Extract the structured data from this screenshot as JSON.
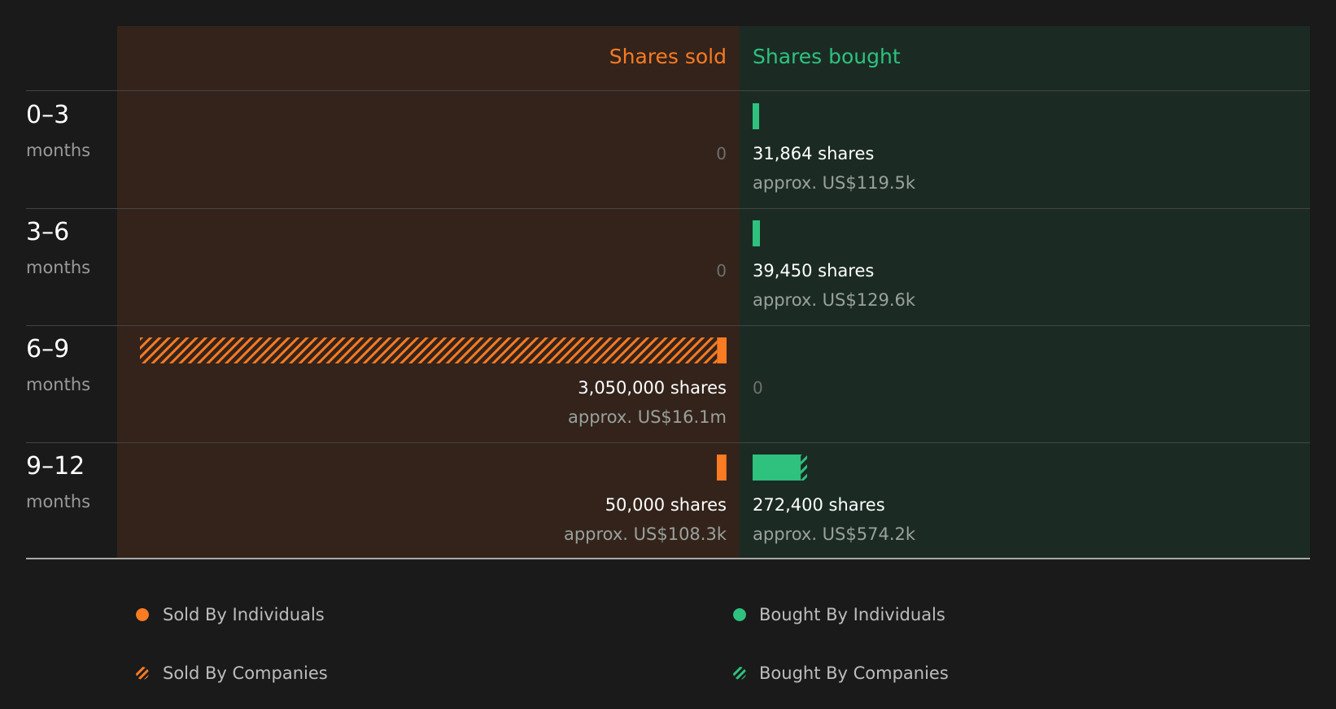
{
  "colors": {
    "sold": "#f97b22",
    "bought": "#2ec27e",
    "sold_panel": "#33231b",
    "bought_panel": "#1b2b24"
  },
  "header": {
    "sold_title": "Shares sold",
    "bought_title": "Shares bought"
  },
  "chart_data": {
    "type": "bar",
    "orientation": "diverging-horizontal",
    "categories": [
      "0–3",
      "3–6",
      "6–9",
      "9–12"
    ],
    "category_unit": "months",
    "x_max_shares": 3100000,
    "rows": [
      {
        "period": "0–3",
        "unit": "months",
        "sold": {
          "zero_label": "0",
          "individuals": 0,
          "companies": 0
        },
        "bought": {
          "individuals": 31864,
          "companies": 0,
          "shares_label": "31,864 shares",
          "value_label": "approx. US$119.5k"
        }
      },
      {
        "period": "3–6",
        "unit": "months",
        "sold": {
          "zero_label": "0",
          "individuals": 0,
          "companies": 0
        },
        "bought": {
          "individuals": 39450,
          "companies": 0,
          "shares_label": "39,450 shares",
          "value_label": "approx. US$129.6k"
        }
      },
      {
        "period": "6–9",
        "unit": "months",
        "sold": {
          "individuals": 50000,
          "companies": 3000000,
          "shares_label": "3,050,000 shares",
          "value_label": "approx. US$16.1m"
        },
        "bought": {
          "zero_label": "0",
          "individuals": 0,
          "companies": 0
        }
      },
      {
        "period": "9–12",
        "unit": "months",
        "sold": {
          "individuals": 50000,
          "companies": 0,
          "shares_label": "50,000 shares",
          "value_label": "approx. US$108.3k"
        },
        "bought": {
          "individuals": 250000,
          "companies": 22400,
          "shares_label": "272,400 shares",
          "value_label": "approx. US$574.2k"
        }
      }
    ],
    "legend": [
      {
        "label": "Sold By Individuals",
        "side": "sold",
        "pattern": "solid"
      },
      {
        "label": "Bought By Individuals",
        "side": "bought",
        "pattern": "solid"
      },
      {
        "label": "Sold By Companies",
        "side": "sold",
        "pattern": "hatched"
      },
      {
        "label": "Bought By Companies",
        "side": "bought",
        "pattern": "hatched"
      }
    ]
  }
}
